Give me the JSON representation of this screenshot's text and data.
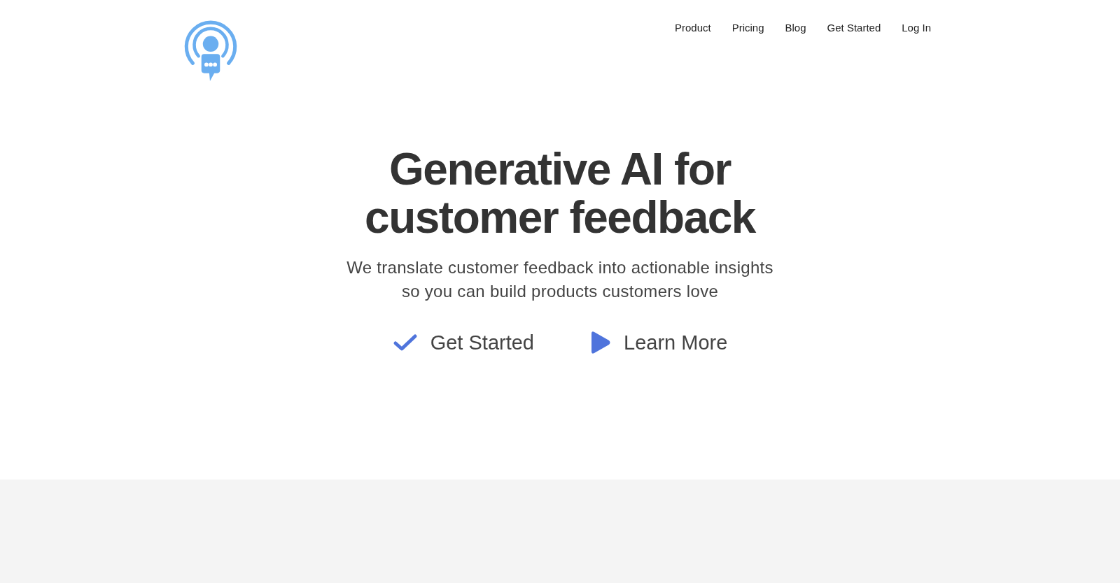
{
  "header": {
    "nav": [
      {
        "label": "Product"
      },
      {
        "label": "Pricing"
      },
      {
        "label": "Blog"
      },
      {
        "label": "Get Started"
      },
      {
        "label": "Log In"
      }
    ]
  },
  "hero": {
    "title_lines": [
      "Generative AI for",
      "customer feedback"
    ],
    "subtitle_lines": [
      "We translate customer feedback into actionable insights",
      "so you can build products customers love"
    ],
    "actions": [
      {
        "kind": "check",
        "label": "Get Started"
      },
      {
        "kind": "play",
        "label": "Learn More"
      }
    ]
  }
}
